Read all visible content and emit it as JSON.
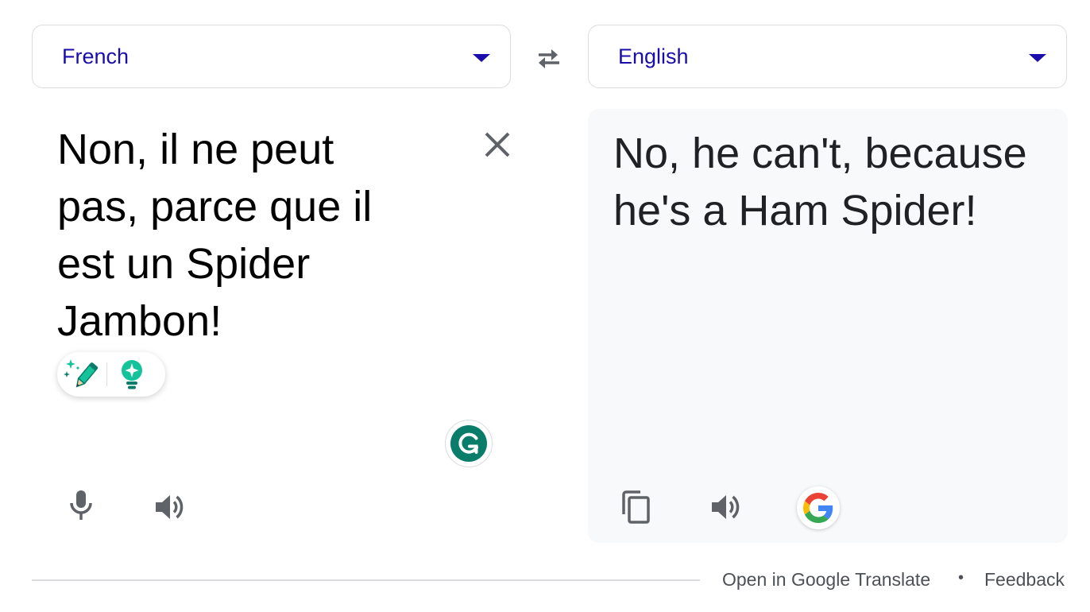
{
  "source_lang": {
    "label": "French"
  },
  "target_lang": {
    "label": "English"
  },
  "source": {
    "text": "Non, il ne peut pas, parce que il est un Spider Jambon!"
  },
  "target": {
    "text": "No, he can't, because he's a Ham Spider!"
  },
  "footer": {
    "open_label": "Open in Google Translate",
    "separator": "•",
    "feedback_label": "Feedback"
  },
  "icons": {
    "swap": "swap-arrows-icon",
    "clear": "close-icon",
    "rewrite": "sparkle-pencil-icon",
    "ideas": "lightbulb-icon",
    "grammarly": "grammarly-icon",
    "mic": "microphone-icon",
    "speaker": "speaker-icon",
    "copy": "copy-icon",
    "google": "google-g-icon"
  },
  "colors": {
    "link": "#1a0dab",
    "grammarly_green": "#15c39a",
    "grammarly_dark": "#0a7c6a",
    "panel_bg": "#f8f9fa",
    "icon_gray": "#5f6368"
  }
}
